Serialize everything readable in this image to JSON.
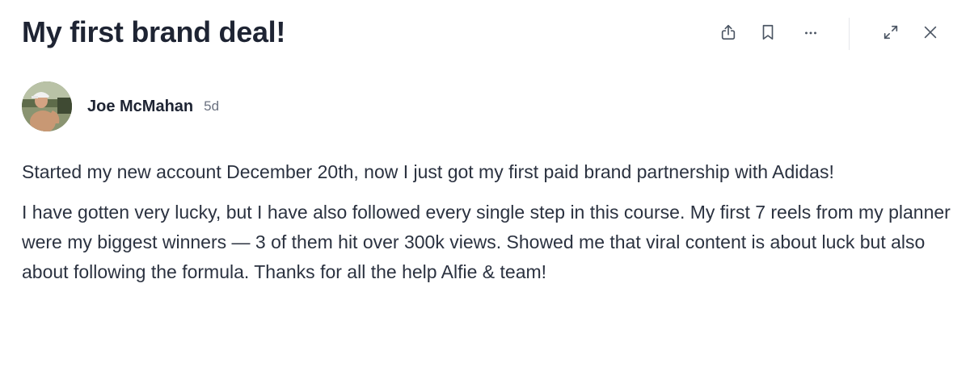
{
  "post": {
    "title": "My first brand deal!",
    "author": {
      "name": "Joe McMahan",
      "time": "5d"
    },
    "paragraphs": [
      "Started my new account December 20th, now I just got my first paid brand partnership with Adidas!",
      "I have gotten very lucky, but I have also followed every single step in this course. My first 7 reels from my planner were my biggest winners — 3 of them hit over 300k views. Showed me that viral content is about luck but also about following the formula. Thanks for all the help Alfie & team!"
    ]
  },
  "toolbar": {
    "icons": [
      "share-icon",
      "bookmark-icon",
      "more-icon",
      "expand-icon",
      "close-icon"
    ]
  }
}
